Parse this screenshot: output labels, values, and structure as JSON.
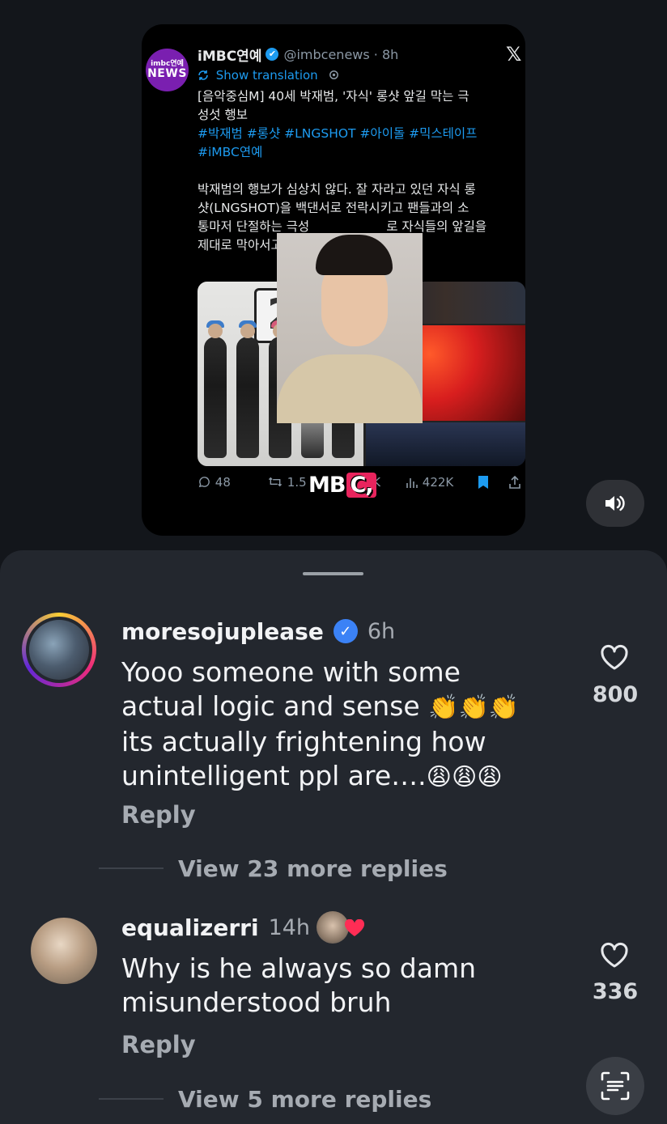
{
  "video": {
    "tweet": {
      "avatar_top": "imbc연예",
      "avatar_bottom": "NEWS",
      "name": "iMBC연예",
      "verified": "✔",
      "handle": "@imbcenews · 8h",
      "x_logo": "𝕏",
      "show_translation": "Show translation",
      "title_line1": "[음악중심M] 40세 박재범, '자식' 롱샷 앞길 막는 극",
      "title_line2": "성섯 행보",
      "hashtags_line1": "#박재범 #롱샷 #LNGSHOT #아이돌 #믹스테이프",
      "hashtags_line2": "#iMBC연예",
      "body_line1": "박재범의 행보가 심상치 않다. 잘 자라고 있던 자식 롱",
      "body_line2": "샷(LNGSHOT)을 백댄서로 전락시키고 팬들과의 소",
      "body_line3": "통마저 단절하는 극성",
      "body_line3b": "로 자식들의 앞길을",
      "body_line4": "제대로 막아서고 있다",
      "media_logo": "2",
      "stats": {
        "comments": "48",
        "reposts": "1.5",
        "likes_fragment": ".9K",
        "views": "422K"
      }
    },
    "watermark": {
      "mb": "MB",
      "c": "C,"
    }
  },
  "comments": [
    {
      "username": "moresojuplease",
      "verified": true,
      "time": "6h",
      "text_lines": [
        "Yooo someone with some",
        "actual logic and sense",
        "its actually frightening how",
        "unintelligent ppl are…."
      ],
      "emoji_line2": "👏👏👏",
      "emoji_line4": "😩😩😩",
      "reply_label": "Reply",
      "likes": "800",
      "view_replies": "View 23 more replies"
    },
    {
      "username": "equalizerri",
      "time": "14h",
      "text_lines": [
        "Why is he always so damn",
        "misunderstood bruh"
      ],
      "reply_label": "Reply",
      "likes": "336",
      "view_replies": "View 5 more replies"
    }
  ],
  "icons": {
    "sound": "speaker-icon",
    "like": "heart-icon",
    "scan": "scan-text-icon"
  },
  "colors": {
    "background": "#13161b",
    "sheet": "#23272e",
    "accent_blue": "#1d9bf0",
    "verified_blue": "#3b82f6",
    "mbc_pink": "#e8245d"
  }
}
